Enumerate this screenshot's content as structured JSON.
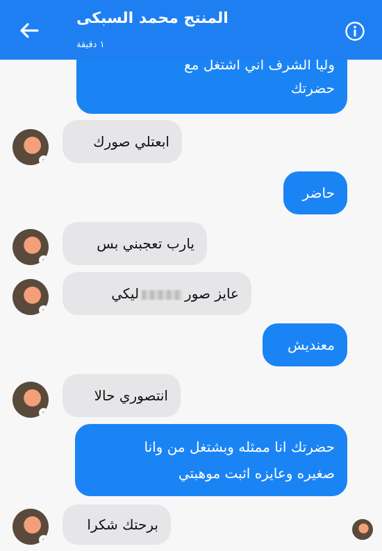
{
  "header": {
    "contact_name": "المنتج محمد السبكى",
    "status": "١ دقيقة",
    "back_icon": "arrow-left-icon",
    "info_icon": "info-circle-icon"
  },
  "messages": {
    "m0_line1": "وليا الشرف اني اشتغل مع",
    "m0_line2": "حضرتك",
    "m1": "ابعتلي صورك",
    "m2": "حاضر",
    "m3": "يارب تعجبني بس",
    "m4_before": "عايز صور",
    "m4_after": "ليكي",
    "m5": "معنديش",
    "m6": "انتصوري حالا",
    "m7_line1": "حضرتك انا ممثله وبشتغل من وانا",
    "m7_line2": "صغيره وعايزه اثبت موهبتي",
    "m8": "برحتك شكرا"
  },
  "colors": {
    "header": "#1e7ff2",
    "outgoing_bubble": "#1b84f5",
    "incoming_bubble": "#e6e6e9",
    "background": "#f7f7f8"
  }
}
